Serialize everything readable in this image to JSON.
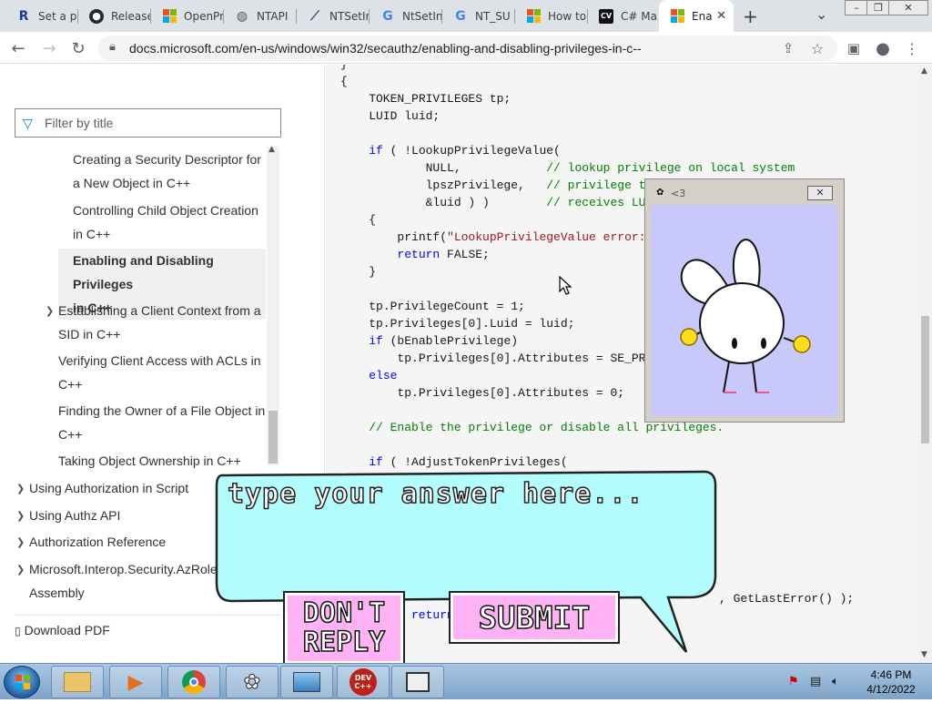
{
  "browser": {
    "tabs": [
      {
        "label": "Set a p",
        "icon": "rider-icon",
        "color": "#1a3b9c"
      },
      {
        "label": "Release",
        "icon": "github-icon",
        "color": "#24292f"
      },
      {
        "label": "OpenPr",
        "icon": "microsoft-icon",
        "color": "#f25022"
      },
      {
        "label": "NTAPI",
        "icon": "globe-icon",
        "color": "#555555"
      },
      {
        "label": "NTSetIn",
        "icon": "ntapi-icon",
        "color": "#2b4c7e"
      },
      {
        "label": "NtSetIn",
        "icon": "google-icon",
        "color": "#4285f4"
      },
      {
        "label": "NT_SU",
        "icon": "google-icon",
        "color": "#4285f4"
      },
      {
        "label": "How to",
        "icon": "microsoft-icon",
        "color": "#f25022"
      },
      {
        "label": "C# Ma",
        "icon": "cv-icon",
        "color": "#111111"
      },
      {
        "label": "Ena",
        "icon": "microsoft-icon",
        "color": "#f25022",
        "active": true
      }
    ],
    "new_tab": "+",
    "tab_search": "⌄",
    "window_buttons": [
      "–",
      "❐",
      "✕"
    ],
    "url": "docs.microsoft.com/en-us/windows/win32/secauthz/enabling-and-disabling-privileges-in-c--"
  },
  "sidebar": {
    "filter_placeholder": "Filter by title",
    "items": [
      {
        "label_line1": "Creating a Security Descriptor for",
        "label_line2": "a New Object in C++"
      },
      {
        "label_line1": "Controlling Child Object Creation",
        "label_line2": "in C++"
      },
      {
        "label_line1": "Enabling and Disabling Privileges",
        "label_line2": "in C++",
        "selected": true
      },
      {
        "label_line1": "Establishing a Client Context from a",
        "label_line2": "SID in C++",
        "expandable": true
      },
      {
        "label_line1": "Verifying Client Access with ACLs in",
        "label_line2": "C++"
      },
      {
        "label_line1": "Finding the Owner of a File Object in",
        "label_line2": "C++"
      },
      {
        "label_line1": "Taking Object Ownership in C++",
        "label_line2": ""
      },
      {
        "label_line1": "Using Authorization in Script",
        "label_line2": "",
        "expandable": true
      },
      {
        "label_line1": "Using Authz API",
        "label_line2": "",
        "expandable": true
      },
      {
        "label_line1": "Authorization Reference",
        "label_line2": "",
        "expandable": true
      },
      {
        "label_line1": "Microsoft.Interop.Security.AzRoles",
        "label_line2": "Assembly",
        "expandable": true
      }
    ],
    "download_pdf": "Download PDF"
  },
  "code": {
    "lines": [
      "}",
      "{",
      "    TOKEN_PRIVILEGES tp;",
      "    LUID luid;",
      "",
      "    if ( !LookupPrivilegeValue(",
      "            NULL,            // lookup privilege on local system",
      "            lpszPrivilege,   // privilege to",
      "            &luid ) )        // receives LUI",
      "    {",
      "        printf(\"LookupPrivilegeValue error:",
      "        return FALSE;",
      "    }",
      "",
      "    tp.PrivilegeCount = 1;",
      "    tp.Privileges[0].Luid = luid;",
      "    if (bEnablePrivilege)",
      "        tp.Privileges[0].Attributes = SE_PRI",
      "    else",
      "        tp.Privileges[0].Attributes = 0;",
      "",
      "    // Enable the privilege or disable all privileges.",
      "",
      "    if ( !AdjustTokenPrivileges("
    ],
    "tail_fragment": ", GetLastError() );",
    "return_fragment": "return"
  },
  "bunny_window": {
    "title": "<3",
    "close": "✕"
  },
  "prompt": {
    "placeholder": "type your answer here...",
    "dont_reply": "DON'T REPLY",
    "dont_reply_line1": "DON'T",
    "dont_reply_line2": "REPLY",
    "submit": "SUBMIT"
  },
  "taskbar": {
    "time": "4:46 PM",
    "date": "4/12/2022"
  },
  "colors": {
    "bubble": "#b3fdff",
    "bunny_bg": "#c8c8fa",
    "button_pink": "#ffb3f5",
    "accent": "#0078d4"
  }
}
